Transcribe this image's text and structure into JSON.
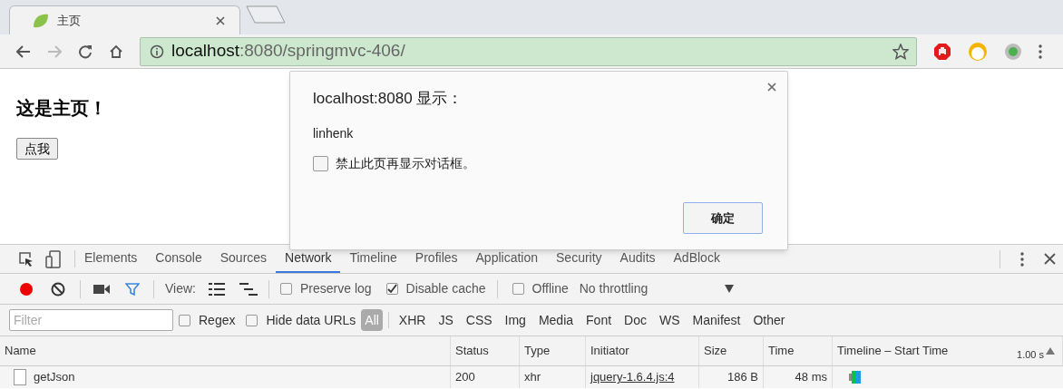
{
  "browser": {
    "tab": {
      "title": "主页"
    },
    "address": {
      "host": "localhost",
      "path": ":8080/springmvc-406/"
    }
  },
  "page": {
    "heading": "这是主页！",
    "button": "点我"
  },
  "dialog": {
    "title": "localhost:8080 显示：",
    "message": "linhenk",
    "checkbox": {
      "label": "禁止此页再显示对话框。",
      "checked": false
    },
    "ok": "确定"
  },
  "devtools": {
    "tabs": [
      {
        "label": "Elements",
        "selected": false
      },
      {
        "label": "Console",
        "selected": false
      },
      {
        "label": "Sources",
        "selected": false
      },
      {
        "label": "Network",
        "selected": true
      },
      {
        "label": "Timeline",
        "selected": false
      },
      {
        "label": "Profiles",
        "selected": false
      },
      {
        "label": "Application",
        "selected": false
      },
      {
        "label": "Security",
        "selected": false
      },
      {
        "label": "Audits",
        "selected": false
      },
      {
        "label": "AdBlock",
        "selected": false
      }
    ],
    "toolbar": {
      "recording": true,
      "filter_on": true,
      "view_label": "View:",
      "options": [
        {
          "label": "Preserve log",
          "checked": false
        },
        {
          "label": "Disable cache",
          "checked": true
        },
        {
          "label": "Offline",
          "checked": false
        }
      ],
      "throttling": "No throttling"
    },
    "filter": {
      "placeholder": "Filter",
      "options": [
        {
          "label": "Regex",
          "checked": false
        },
        {
          "label": "Hide data URLs",
          "checked": false
        }
      ],
      "types": [
        {
          "label": "All",
          "selected": true
        },
        {
          "label": "XHR",
          "selected": false
        },
        {
          "label": "JS",
          "selected": false
        },
        {
          "label": "CSS",
          "selected": false
        },
        {
          "label": "Img",
          "selected": false
        },
        {
          "label": "Media",
          "selected": false
        },
        {
          "label": "Font",
          "selected": false
        },
        {
          "label": "Doc",
          "selected": false
        },
        {
          "label": "WS",
          "selected": false
        },
        {
          "label": "Manifest",
          "selected": false
        },
        {
          "label": "Other",
          "selected": false
        }
      ]
    },
    "table": {
      "columns": [
        "Name",
        "Status",
        "Type",
        "Initiator",
        "Size",
        "Time",
        "Timeline – Start Time"
      ],
      "timeline_scale": "1.00 s",
      "rows": [
        {
          "cells": [
            "getJson",
            "200",
            "xhr",
            "jquery-1.6.4.js:4",
            "186 B",
            "48 ms"
          ]
        }
      ]
    }
  }
}
